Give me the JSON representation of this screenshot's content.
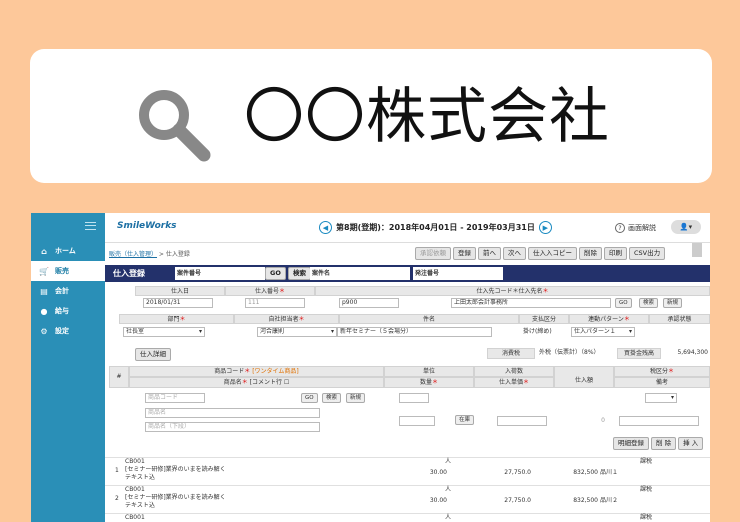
{
  "search": {
    "query": "〇〇株式会社"
  },
  "nav": {
    "items": [
      {
        "label": "ホーム",
        "icon": "home-icon",
        "glyph": "⌂"
      },
      {
        "label": "販売",
        "icon": "cart-icon",
        "glyph": "🛒"
      },
      {
        "label": "会計",
        "icon": "ledger-icon",
        "glyph": "▤"
      },
      {
        "label": "給与",
        "icon": "money-bag-icon",
        "glyph": "●"
      },
      {
        "label": "設定",
        "icon": "gear-icon",
        "glyph": "⚙"
      }
    ]
  },
  "header": {
    "logo": "SmileWorks",
    "period": "第8期(登期)：2018年04月01日 - 2019年03月31日",
    "help": "画面解説"
  },
  "breadcrumb": {
    "parent": "販売（仕入管理）",
    "current": "仕入登録"
  },
  "toolbar": {
    "buttons": [
      "承認依頼",
      "登録",
      "前へ",
      "次へ",
      "仕入入コピー",
      "削除",
      "印刷",
      "CSV出力"
    ]
  },
  "title": {
    "label": "仕入登録",
    "case_no_label": "案件番号",
    "go": "GO",
    "search": "検索",
    "case_name_label": "案件名",
    "order_no_label": "発注番号"
  },
  "form": {
    "date_label": "仕入日",
    "date_value": "2018/01/31",
    "no_label": "仕入番号",
    "no_value": "111",
    "vendor_label": "仕入先コード＊仕入先名",
    "vendor_code": "p900",
    "vendor_name": "上田太郎会計事務所",
    "go": "GO",
    "search": "検索",
    "new": "新規",
    "dept_label": "部門",
    "dept_value": "社長室",
    "staff_label": "自社担当者",
    "staff_value": "河合康則",
    "subject_label": "件名",
    "subject_value": "新年セミナー（５会場分）",
    "pay_label": "支払区分",
    "pay_value": "掛け(締め)",
    "pattern_label": "連動パターン",
    "pattern_value": "仕入パターン１",
    "approval_label": "承認状態"
  },
  "summary": {
    "detail_btn": "仕入詳細",
    "tax_label": "消費税",
    "tax_value": "外税（伝票計）（8%）",
    "total_label": "買掛金残高",
    "total_value": "5,694,300"
  },
  "lines_header": {
    "hash": "#",
    "code": "商品コード",
    "oneshot": "[ワンタイム商品]",
    "name": "商品名",
    "comment": "[コメント行",
    "unit": "単位",
    "qty": "数量",
    "in_qty": "入荷数",
    "price": "仕入単価",
    "amount": "仕入額",
    "tax_kind": "税区分",
    "memo": "備考"
  },
  "entry": {
    "code_ph": "商品コード",
    "go": "GO",
    "search": "検索",
    "new": "新規",
    "name_ph": "商品名",
    "name2_ph": "商品名（下段）",
    "stock_btn": "在庫",
    "amount": "0"
  },
  "line_buttons": [
    "明細登録",
    "削 除",
    "挿 入"
  ],
  "rows": [
    {
      "no": "1",
      "code": "CB001",
      "name": "[セミナー研修]業界のいまを読み解く",
      "name2": "テキスト込",
      "unit": "人",
      "qty": "30.00",
      "price": "27,750.0",
      "amount": "832,500",
      "memo": "品川１",
      "tax": "課税"
    },
    {
      "no": "2",
      "code": "CB001",
      "name": "[セミナー研修]業界のいまを読み解く",
      "name2": "テキスト込",
      "unit": "人",
      "qty": "30.00",
      "price": "27,750.0",
      "amount": "832,500",
      "memo": "品川２",
      "tax": "課税"
    },
    {
      "no": "",
      "code": "CB001",
      "name": "",
      "name2": "",
      "unit": "人",
      "qty": "",
      "price": "",
      "amount": "",
      "memo": "",
      "tax": "課税"
    }
  ]
}
